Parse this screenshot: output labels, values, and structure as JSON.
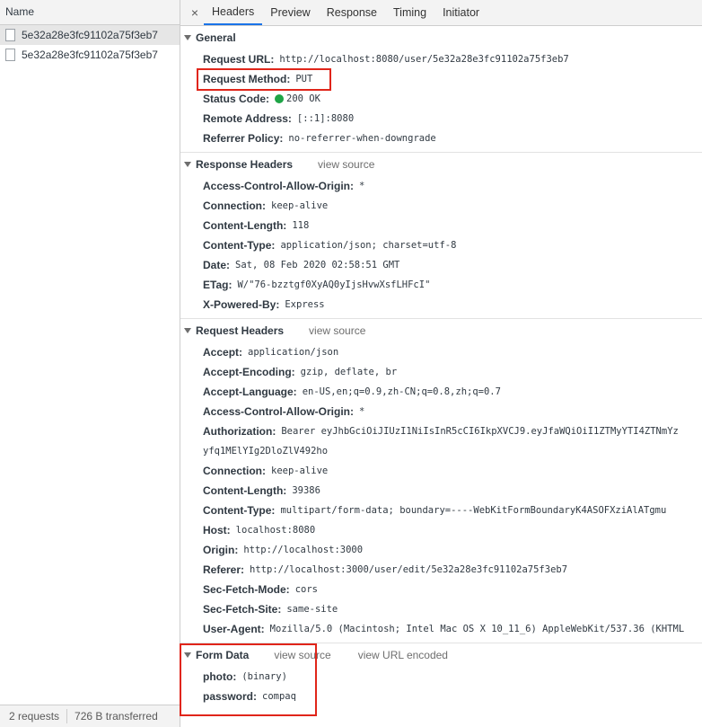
{
  "left": {
    "header": "Name",
    "requests": [
      {
        "name": "5e32a28e3fc91102a75f3eb7"
      },
      {
        "name": "5e32a28e3fc91102a75f3eb7"
      }
    ],
    "footer": {
      "count": "2 requests",
      "transferred": "726 B transferred"
    }
  },
  "tabs": {
    "close": "×",
    "items": [
      "Headers",
      "Preview",
      "Response",
      "Timing",
      "Initiator"
    ]
  },
  "general": {
    "title": "General",
    "rows": [
      {
        "key": "Request URL:",
        "value": "http://localhost:8080/user/5e32a28e3fc91102a75f3eb7"
      },
      {
        "key": "Request Method:",
        "value": "PUT"
      },
      {
        "key": "Status Code:",
        "value": "200 OK"
      },
      {
        "key": "Remote Address:",
        "value": "[::1]:8080"
      },
      {
        "key": "Referrer Policy:",
        "value": "no-referrer-when-downgrade"
      }
    ]
  },
  "response_headers": {
    "title": "Response Headers",
    "link": "view source",
    "rows": [
      {
        "key": "Access-Control-Allow-Origin:",
        "value": "*"
      },
      {
        "key": "Connection:",
        "value": "keep-alive"
      },
      {
        "key": "Content-Length:",
        "value": "118"
      },
      {
        "key": "Content-Type:",
        "value": "application/json; charset=utf-8"
      },
      {
        "key": "Date:",
        "value": "Sat, 08 Feb 2020 02:58:51 GMT"
      },
      {
        "key": "ETag:",
        "value": "W/\"76-bzztgf0XyAQ0yIjsHvwXsfLHFcI\""
      },
      {
        "key": "X-Powered-By:",
        "value": "Express"
      }
    ]
  },
  "request_headers": {
    "title": "Request Headers",
    "link": "view source",
    "rows": [
      {
        "key": "Accept:",
        "value": "application/json"
      },
      {
        "key": "Accept-Encoding:",
        "value": "gzip, deflate, br"
      },
      {
        "key": "Accept-Language:",
        "value": "en-US,en;q=0.9,zh-CN;q=0.8,zh;q=0.7"
      },
      {
        "key": "Access-Control-Allow-Origin:",
        "value": "*"
      },
      {
        "key": "Authorization:",
        "value": "Bearer eyJhbGciOiJIUzI1NiIsInR5cCI6IkpXVCJ9.eyJfaWQiOiI1ZTMyYTI4ZTNmYz"
      },
      {
        "key": "",
        "value": "yfq1MElYIg2DloZlV492ho"
      },
      {
        "key": "Connection:",
        "value": "keep-alive"
      },
      {
        "key": "Content-Length:",
        "value": "39386"
      },
      {
        "key": "Content-Type:",
        "value": "multipart/form-data; boundary=----WebKitFormBoundaryK4ASOFXziAlATgmu"
      },
      {
        "key": "Host:",
        "value": "localhost:8080"
      },
      {
        "key": "Origin:",
        "value": "http://localhost:3000"
      },
      {
        "key": "Referer:",
        "value": "http://localhost:3000/user/edit/5e32a28e3fc91102a75f3eb7"
      },
      {
        "key": "Sec-Fetch-Mode:",
        "value": "cors"
      },
      {
        "key": "Sec-Fetch-Site:",
        "value": "same-site"
      },
      {
        "key": "User-Agent:",
        "value": "Mozilla/5.0 (Macintosh; Intel Mac OS X 10_11_6) AppleWebKit/537.36 (KHTML"
      }
    ]
  },
  "form_data": {
    "title": "Form Data",
    "link_source": "view source",
    "link_url": "view URL encoded",
    "rows": [
      {
        "key": "photo:",
        "value": "(binary)"
      },
      {
        "key": "password:",
        "value": "compaq"
      }
    ]
  },
  "colors": {
    "highlight": "#e0251a",
    "status_ok": "#1ea446",
    "active_tab": "#1a73e8"
  }
}
